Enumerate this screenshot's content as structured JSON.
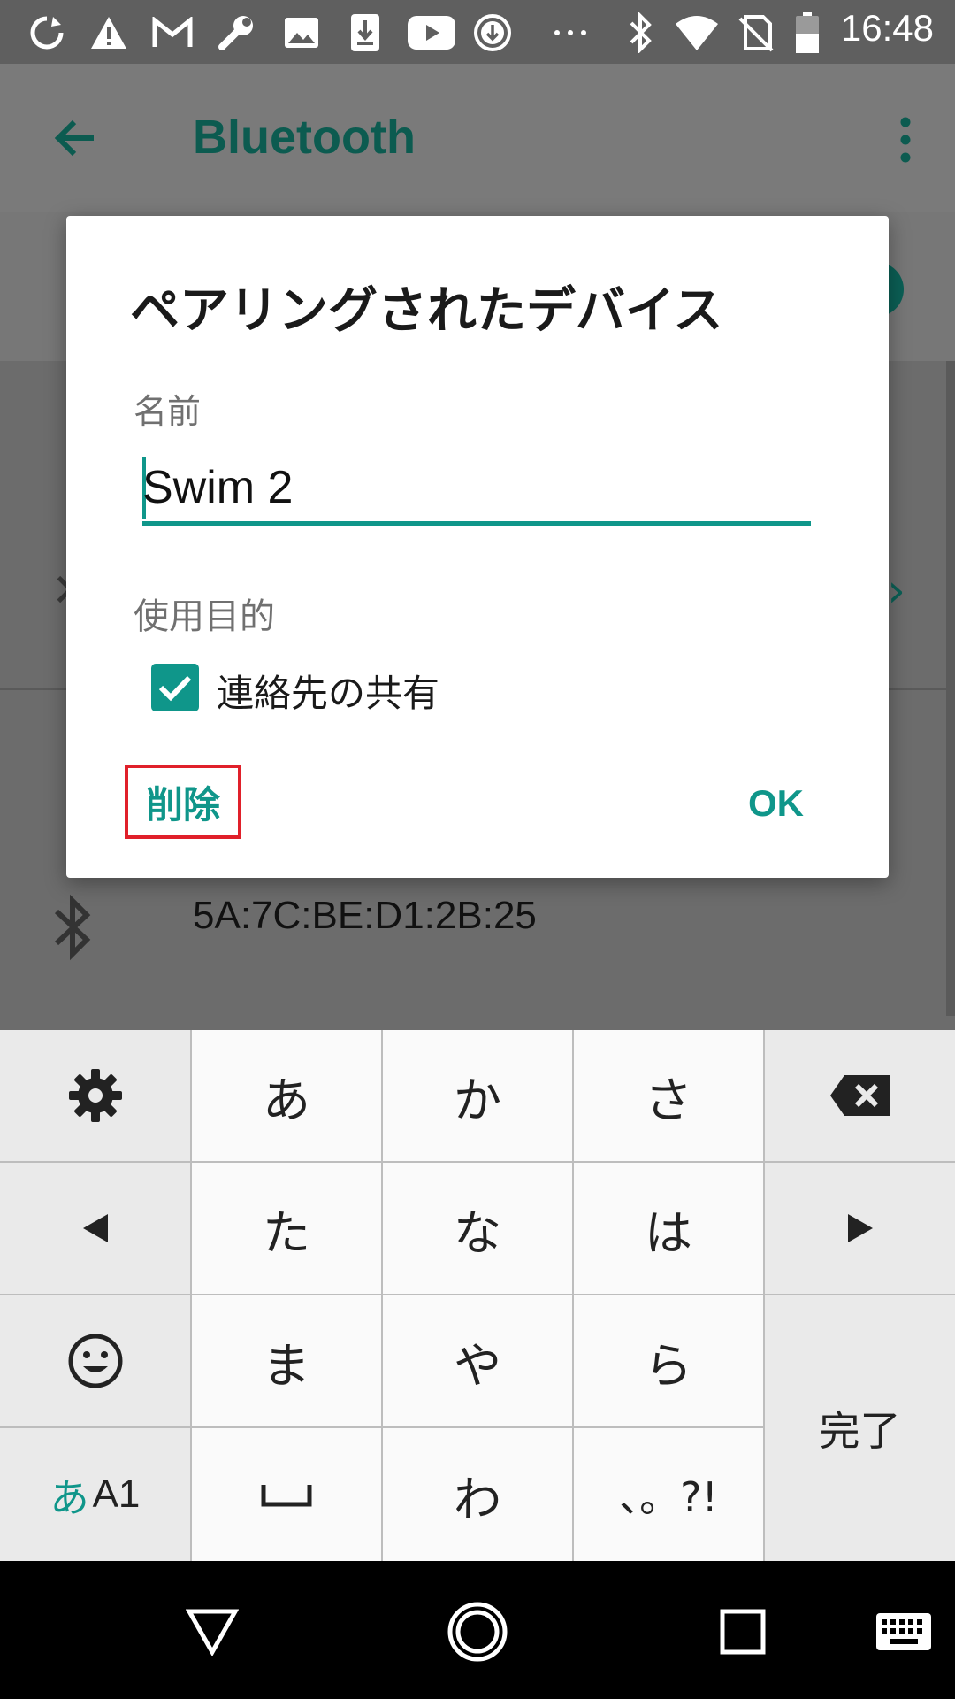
{
  "status_bar": {
    "time": "16:48",
    "icons": [
      "sync-icon",
      "warning-icon",
      "gmail-icon",
      "wrench-icon",
      "image-icon",
      "download-box-icon",
      "youtube-icon",
      "download-circle-icon",
      "more-dots-icon",
      "bluetooth-icon",
      "wifi-icon",
      "no-sim-icon",
      "battery-icon"
    ]
  },
  "app_bar": {
    "title": "Bluetooth",
    "back_icon": "arrow-back-icon",
    "menu_icon": "more-vert-icon"
  },
  "background": {
    "device_address": "5A:7C:BE:D1:2B:25"
  },
  "dialog": {
    "title": "ペアリングされたデバイス",
    "name_label": "名前",
    "name_value": "Swim 2",
    "purpose_label": "使用目的",
    "contact_sharing_label": "連絡先の共有",
    "contact_sharing_checked": true,
    "delete_label": "削除",
    "ok_label": "OK"
  },
  "keyboard": {
    "keys": {
      "a": "あ",
      "ka": "か",
      "sa": "さ",
      "ta": "た",
      "na": "な",
      "ha": "は",
      "ma": "ま",
      "ya": "や",
      "ra": "ら",
      "wa": "わ",
      "punct": "、。?!",
      "done": "完了",
      "mode_kana": "あ",
      "mode_alnum": "A1"
    },
    "accent": "#0f968a"
  },
  "colors": {
    "accent": "#0f968a",
    "highlight_box": "#e0202a"
  }
}
